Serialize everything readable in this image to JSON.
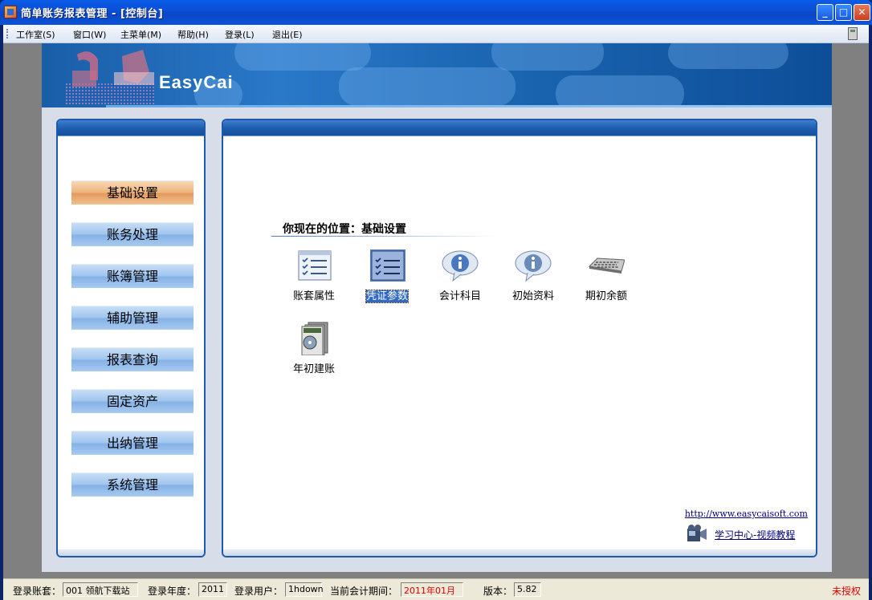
{
  "window": {
    "title": "简单账务报表管理 - [控制台]",
    "min_label": "_",
    "max_label": "□",
    "close_label": "✕"
  },
  "menu": {
    "items": [
      "工作室(S)",
      "窗口(W)",
      "主菜单(M)",
      "帮助(H)",
      "登录(L)",
      "退出(E)"
    ]
  },
  "banner": {
    "title": "EasyCai"
  },
  "nav": {
    "items": [
      "基础设置",
      "账务处理",
      "账簿管理",
      "辅助管理",
      "报表查询",
      "固定资产",
      "出纳管理",
      "系统管理"
    ],
    "active": "基础设置"
  },
  "content": {
    "location": "你现在的位置：基础设置",
    "tiles": [
      {
        "label": "账套属性",
        "icon": "checklist-icon"
      },
      {
        "label": "凭证参数",
        "icon": "checklist-icon",
        "selected": true
      },
      {
        "label": "会计科目",
        "icon": "info-bubble-icon"
      },
      {
        "label": "初始资料",
        "icon": "info-bubble-icon"
      },
      {
        "label": "期初余额",
        "icon": "keyboard-icon"
      },
      {
        "label": "年初建账",
        "icon": "software-box-icon"
      }
    ],
    "url": "http://www.easycaisoft.com",
    "video_link": "学习中心-视频教程"
  },
  "statusbar": {
    "account_label": "登录账套：",
    "account_value": "001 领航下载站",
    "year_label": "登录年度：",
    "year_value": "2011",
    "user_label": "登录用户：",
    "user_value": "1hdown",
    "period_label": "当前会计期间：",
    "period_value": "2011年01月",
    "version_label": "版本：",
    "version_value": "5.82",
    "auth_status": "未授权"
  },
  "colors": {
    "titlebar": "#0b4fd6",
    "nav_active": "#eeb27a",
    "nav_normal": "#9ec4ee",
    "period_value": "#e00000"
  }
}
